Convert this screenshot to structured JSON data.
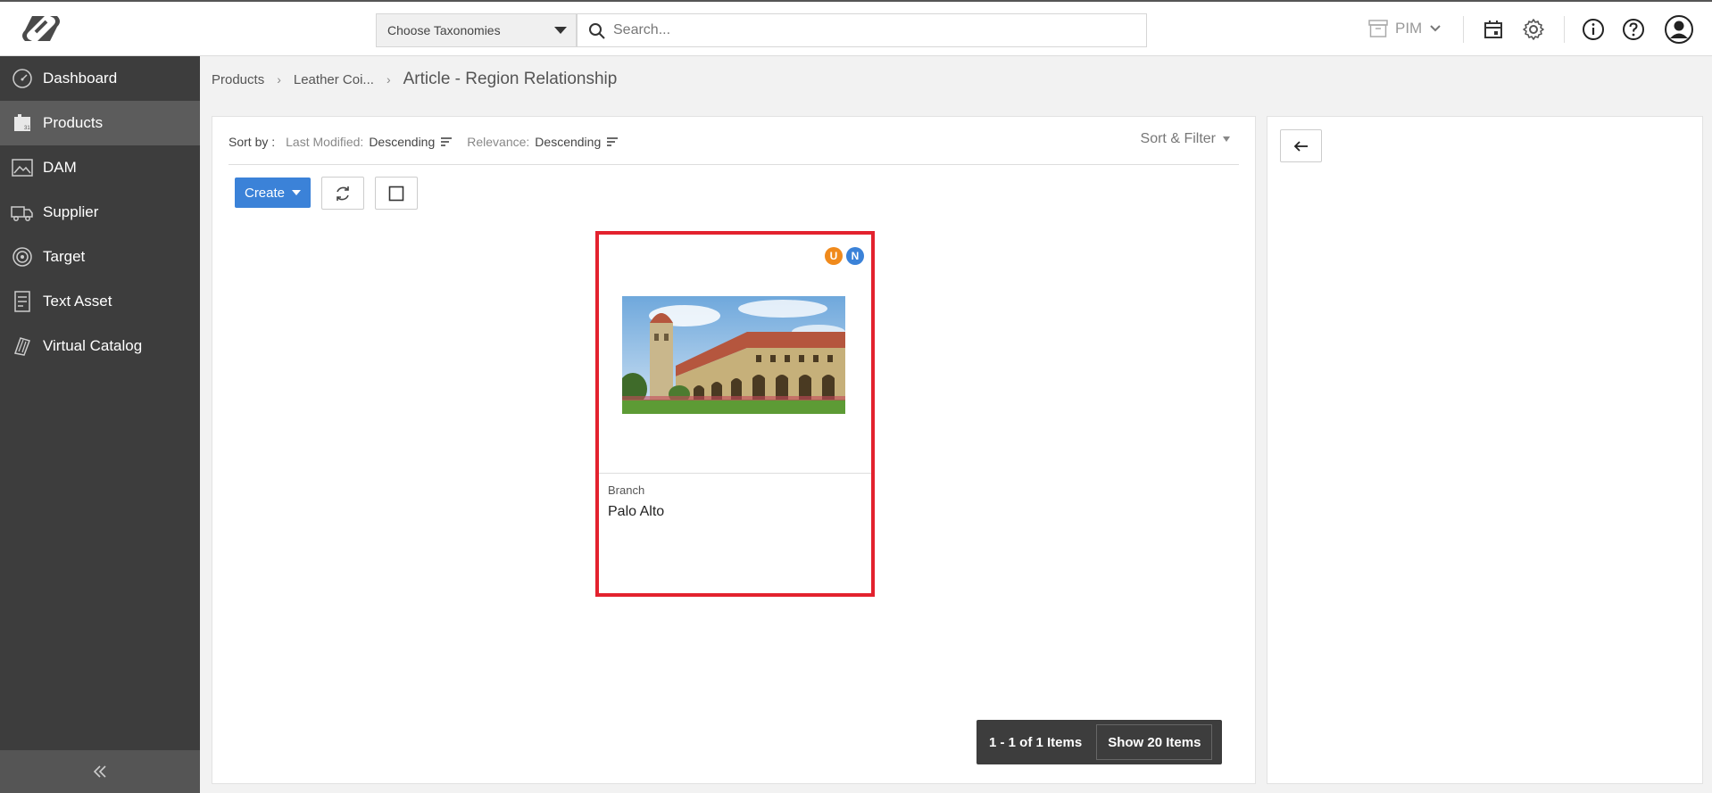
{
  "header": {
    "taxonomy_select": "Choose Taxonomies",
    "search_placeholder": "Search...",
    "module": "PIM"
  },
  "sidebar": {
    "items": [
      {
        "label": "Dashboard",
        "icon": "dashboard-icon"
      },
      {
        "label": "Products",
        "icon": "products-icon"
      },
      {
        "label": "DAM",
        "icon": "image-icon"
      },
      {
        "label": "Supplier",
        "icon": "truck-icon"
      },
      {
        "label": "Target",
        "icon": "target-icon"
      },
      {
        "label": "Text Asset",
        "icon": "document-icon"
      },
      {
        "label": "Virtual Catalog",
        "icon": "catalog-icon"
      }
    ],
    "active": "Products"
  },
  "breadcrumb": {
    "items": [
      "Products",
      "Leather Coi..."
    ],
    "current": "Article - Region Relationship"
  },
  "sortbar": {
    "label": "Sort by :",
    "last_modified_label": "Last Modified:",
    "last_modified_value": "Descending",
    "relevance_label": "Relevance:",
    "relevance_value": "Descending",
    "sort_filter": "Sort & Filter"
  },
  "toolbar": {
    "create_label": "Create"
  },
  "card": {
    "badges": [
      {
        "letter": "U",
        "color": "#f08a1c"
      },
      {
        "letter": "N",
        "color": "#3b82d8"
      }
    ],
    "type": "Branch",
    "name": "Palo Alto"
  },
  "pagination": {
    "count": "1 - 1 of 1 Items",
    "show": "Show 20 Items"
  },
  "colors": {
    "accent": "#3b82d8",
    "highlight": "#e3222e",
    "sidebar": "#3d3d3d"
  }
}
